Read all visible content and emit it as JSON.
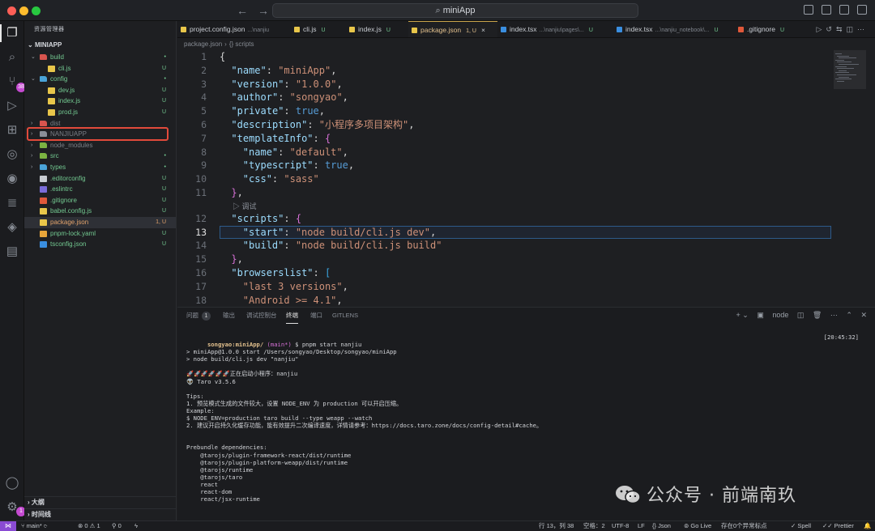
{
  "window": {
    "search_text": "miniApp"
  },
  "activity": {
    "badge": "38",
    "account_badge": "1"
  },
  "sidebar": {
    "title": "资源管理器",
    "section": "MINIAPP",
    "tree": [
      {
        "name": "build",
        "type": "folder",
        "open": true,
        "depth": 0,
        "status": "•",
        "status_color": "green",
        "name_color": "green",
        "icon_color": "#d8544e"
      },
      {
        "name": "cli.js",
        "type": "file",
        "depth": 1,
        "status": "U",
        "status_color": "green",
        "name_color": "green",
        "icon_color": "#e8c64a"
      },
      {
        "name": "config",
        "type": "folder",
        "open": true,
        "depth": 0,
        "status": "•",
        "status_color": "green",
        "name_color": "green",
        "icon_color": "#4aa3d8"
      },
      {
        "name": "dev.js",
        "type": "file",
        "depth": 1,
        "status": "U",
        "status_color": "green",
        "name_color": "green",
        "icon_color": "#e8c64a"
      },
      {
        "name": "index.js",
        "type": "file",
        "depth": 1,
        "status": "U",
        "status_color": "green",
        "name_color": "green",
        "icon_color": "#e8c64a"
      },
      {
        "name": "prod.js",
        "type": "file",
        "depth": 1,
        "status": "U",
        "status_color": "green",
        "name_color": "green",
        "icon_color": "#e8c64a"
      },
      {
        "name": "dist",
        "type": "folder",
        "open": false,
        "depth": 0,
        "status": "",
        "status_color": "gray",
        "name_color": "gray",
        "icon_color": "#d8544e"
      },
      {
        "name": "NANJIUAPP",
        "type": "folder",
        "open": false,
        "depth": 0,
        "status": "",
        "status_color": "gray",
        "name_color": "gray",
        "icon_color": "#8a8f98"
      },
      {
        "name": "node_modules",
        "type": "folder",
        "open": false,
        "depth": 0,
        "status": "",
        "status_color": "gray",
        "name_color": "gray",
        "icon_color": "#7cb342"
      },
      {
        "name": "src",
        "type": "folder",
        "open": false,
        "depth": 0,
        "status": "•",
        "status_color": "green",
        "name_color": "green",
        "icon_color": "#7cb342"
      },
      {
        "name": "types",
        "type": "folder",
        "open": false,
        "depth": 0,
        "status": "•",
        "status_color": "green",
        "name_color": "green",
        "icon_color": "#4aa3d8"
      },
      {
        "name": ".editorconfig",
        "type": "file",
        "depth": 0,
        "status": "U",
        "status_color": "green",
        "name_color": "green",
        "icon_color": "#c8ccd2"
      },
      {
        "name": ".eslintrc",
        "type": "file",
        "depth": 0,
        "status": "U",
        "status_color": "green",
        "name_color": "green",
        "icon_color": "#7a6cd8"
      },
      {
        "name": ".gitignore",
        "type": "file",
        "depth": 0,
        "status": "U",
        "status_color": "green",
        "name_color": "green",
        "icon_color": "#e0583a"
      },
      {
        "name": "babel.config.js",
        "type": "file",
        "depth": 0,
        "status": "U",
        "status_color": "green",
        "name_color": "green",
        "icon_color": "#e8c64a"
      },
      {
        "name": "package.json",
        "type": "file",
        "depth": 0,
        "status": "1, U",
        "status_color": "orange",
        "name_color": "orange",
        "icon_color": "#e8c64a",
        "selected": true
      },
      {
        "name": "pnpm-lock.yaml",
        "type": "file",
        "depth": 0,
        "status": "U",
        "status_color": "green",
        "name_color": "green",
        "icon_color": "#e8a53a"
      },
      {
        "name": "tsconfig.json",
        "type": "file",
        "depth": 0,
        "status": "U",
        "status_color": "green",
        "name_color": "green",
        "icon_color": "#3a8ee0"
      }
    ],
    "outline_label": "大纲",
    "timeline_label": "时间线"
  },
  "tabs": [
    {
      "name": "project.config.json",
      "path": "...\\nanjiu",
      "status": "",
      "icon_color": "#e8c64a",
      "active": false
    },
    {
      "name": "cli.js",
      "path": "",
      "status": "U",
      "icon_color": "#e8c64a",
      "active": false
    },
    {
      "name": "index.js",
      "path": "",
      "status": "U",
      "icon_color": "#e8c64a",
      "active": false
    },
    {
      "name": "package.json",
      "path": "",
      "status": "1, U",
      "icon_color": "#e8c64a",
      "active": true
    },
    {
      "name": "index.tsx",
      "path": "...\\nanjiu\\pages\\...",
      "status": "U",
      "icon_color": "#3a8ee0",
      "active": false
    },
    {
      "name": "index.tsx",
      "path": "...\\nanjiu_notebook\\...",
      "status": "U",
      "icon_color": "#3a8ee0",
      "active": false
    },
    {
      "name": ".gitignore",
      "path": "",
      "status": "U",
      "icon_color": "#e0583a",
      "active": false
    }
  ],
  "breadcrumb": {
    "file": "package.json",
    "symbol": "{} scripts"
  },
  "editor": {
    "codelens": "▷ 调试",
    "lines": [
      {
        "n": "1",
        "indent": 0,
        "tokens": [
          [
            "p",
            "{"
          ]
        ]
      },
      {
        "n": "2",
        "indent": 1,
        "tokens": [
          [
            "k",
            "\"name\""
          ],
          [
            "p",
            ": "
          ],
          [
            "s",
            "\"miniApp\""
          ],
          [
            "p",
            ","
          ]
        ]
      },
      {
        "n": "3",
        "indent": 1,
        "tokens": [
          [
            "k",
            "\"version\""
          ],
          [
            "p",
            ": "
          ],
          [
            "s",
            "\"1.0.0\""
          ],
          [
            "p",
            ","
          ]
        ]
      },
      {
        "n": "4",
        "indent": 1,
        "tokens": [
          [
            "k",
            "\"author\""
          ],
          [
            "p",
            ": "
          ],
          [
            "s",
            "\"songyao\""
          ],
          [
            "p",
            ","
          ]
        ]
      },
      {
        "n": "5",
        "indent": 1,
        "tokens": [
          [
            "k",
            "\"private\""
          ],
          [
            "p",
            ": "
          ],
          [
            "b",
            "true"
          ],
          [
            "p",
            ","
          ]
        ]
      },
      {
        "n": "6",
        "indent": 1,
        "tokens": [
          [
            "k",
            "\"description\""
          ],
          [
            "p",
            ": "
          ],
          [
            "s",
            "\"小程序多项目架构\""
          ],
          [
            "p",
            ","
          ]
        ]
      },
      {
        "n": "7",
        "indent": 1,
        "tokens": [
          [
            "k",
            "\"templateInfo\""
          ],
          [
            "p",
            ": "
          ],
          [
            "brace2",
            "{"
          ]
        ]
      },
      {
        "n": "8",
        "indent": 2,
        "tokens": [
          [
            "k",
            "\"name\""
          ],
          [
            "p",
            ": "
          ],
          [
            "s",
            "\"default\""
          ],
          [
            "p",
            ","
          ]
        ]
      },
      {
        "n": "9",
        "indent": 2,
        "tokens": [
          [
            "k",
            "\"typescript\""
          ],
          [
            "p",
            ": "
          ],
          [
            "b",
            "true"
          ],
          [
            "p",
            ","
          ]
        ]
      },
      {
        "n": "10",
        "indent": 2,
        "tokens": [
          [
            "k",
            "\"css\""
          ],
          [
            "p",
            ": "
          ],
          [
            "s",
            "\"sass\""
          ]
        ]
      },
      {
        "n": "11",
        "indent": 1,
        "tokens": [
          [
            "brace2",
            "}"
          ],
          [
            "p",
            ","
          ]
        ]
      },
      {
        "n": "12",
        "indent": 1,
        "tokens": [
          [
            "k",
            "\"scripts\""
          ],
          [
            "p",
            ": "
          ],
          [
            "brace2",
            "{"
          ]
        ]
      },
      {
        "n": "13",
        "indent": 2,
        "tokens": [
          [
            "k",
            "\"start\""
          ],
          [
            "p",
            ": "
          ],
          [
            "s",
            "\"node build/cli.js dev\""
          ],
          [
            "p",
            ","
          ]
        ],
        "current": true
      },
      {
        "n": "14",
        "indent": 2,
        "tokens": [
          [
            "k",
            "\"build\""
          ],
          [
            "p",
            ": "
          ],
          [
            "s",
            "\"node build/cli.js build\""
          ]
        ]
      },
      {
        "n": "15",
        "indent": 1,
        "tokens": [
          [
            "brace2",
            "}"
          ],
          [
            "p",
            ","
          ]
        ]
      },
      {
        "n": "16",
        "indent": 1,
        "tokens": [
          [
            "k",
            "\"browserslist\""
          ],
          [
            "p",
            ": "
          ],
          [
            "brace3",
            "["
          ]
        ]
      },
      {
        "n": "17",
        "indent": 2,
        "tokens": [
          [
            "s",
            "\"last 3 versions\""
          ],
          [
            "p",
            ","
          ]
        ]
      },
      {
        "n": "18",
        "indent": 2,
        "tokens": [
          [
            "s",
            "\"Android >= 4.1\""
          ],
          [
            "p",
            ","
          ]
        ]
      }
    ]
  },
  "panel": {
    "tabs": [
      {
        "label": "问题",
        "badge": "1"
      },
      {
        "label": "输出"
      },
      {
        "label": "调试控制台"
      },
      {
        "label": "终端",
        "active": true
      },
      {
        "label": "端口"
      },
      {
        "label": "GITLENS"
      }
    ],
    "shell": "node"
  },
  "terminal": {
    "prompt_user": "songyao:miniApp/",
    "prompt_branch": "(main*)",
    "command": "$ pnpm start nanjiu",
    "time": "[20:45:32]",
    "lines": [
      "",
      "> miniApp@1.0.0 start /Users/songyao/Desktop/songyao/miniApp",
      "> node build/cli.js dev \"nanjiu\"",
      "",
      "🚀🚀🚀🚀🚀🚀正在启动小程序：nanjiu",
      "👽 Taro v3.5.6",
      "",
      "Tips:",
      "1. 预览模式生成的文件较大，设置 NODE_ENV 为 production 可以开启压缩。",
      "Example:",
      "$ NODE_ENV=production taro build --type weapp --watch",
      "2. 建议开启持久化缓存功能，能有效提升二次编译速度，详情请参考：https://docs.taro.zone/docs/config-detail#cache。",
      "",
      "",
      "Prebundle dependencies:",
      "    @tarojs/plugin-framework-react/dist/runtime",
      "    @tarojs/plugin-platform-weapp/dist/runtime",
      "    @tarojs/runtime",
      "    @tarojs/taro",
      "    react",
      "    react-dom",
      "    react/jsx-runtime"
    ]
  },
  "watermark": "公众号 · 前端南玖",
  "statusbar": {
    "branch": "main*",
    "errors": "0",
    "warnings": "1",
    "ports": "0",
    "position": "行 13，列 38",
    "spaces": "空格：2",
    "encoding": "UTF-8",
    "eol": "LF",
    "language": "Json",
    "golive": "Go Live",
    "breakpoints": "存在0个异常标点",
    "spell": "Spell",
    "prettier": "Prettier"
  }
}
